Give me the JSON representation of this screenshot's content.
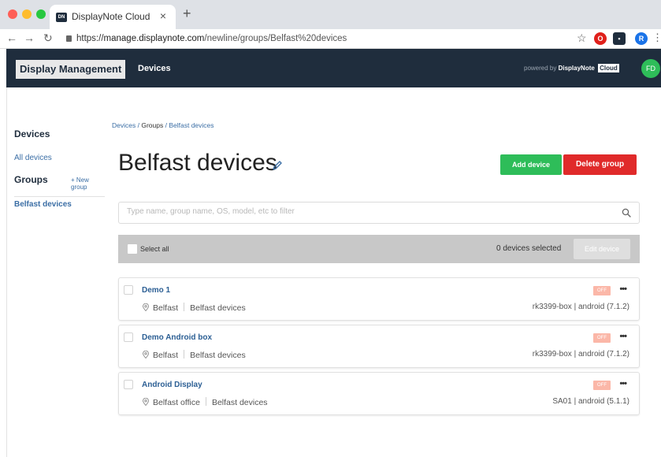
{
  "browser": {
    "tab_title": "DisplayNote Cloud",
    "favicon_text": "DN",
    "url_scheme": "https://",
    "url_domain": "manage.displaynote.com",
    "url_path": "/newline/groups/Belfast%20devices",
    "ext_profile_initial": "R"
  },
  "header": {
    "brand_label": "Display Management",
    "nav_devices": "Devices",
    "powered_prefix": "powered by",
    "powered_brand": "DisplayNote",
    "powered_badge": "Cloud",
    "avatar_initials": "FD",
    "colors": {
      "bg": "#1f2d3d",
      "avatar": "#2ebd59"
    }
  },
  "sidebar": {
    "title": "Devices",
    "all_devices": "All devices",
    "groups_title": "Groups",
    "new_group": "+ New group",
    "groups": [
      "Belfast devices"
    ]
  },
  "main": {
    "breadcrumb": {
      "devices": "Devices",
      "groups": "Groups",
      "current": "Belfast devices",
      "separator": "/"
    },
    "title": "Belfast devices",
    "add_device": "Add device",
    "delete_group": "Delete group",
    "filter_placeholder": "Type name, group name, OS, model, etc to filter",
    "select_all": "Select all",
    "selected_count": "0 devices selected",
    "edit_device": "Edit device",
    "colors": {
      "add": "#2ebd59",
      "delete": "#e02a2a",
      "link": "#3b6ea5",
      "off_badge": "#fbb7a8"
    }
  },
  "devices": [
    {
      "name": "Demo 1",
      "location": "Belfast",
      "group": "Belfast devices",
      "status": "OFF",
      "model": "rk3399-box | android (7.1.2)"
    },
    {
      "name": "Demo Android box",
      "location": "Belfast",
      "group": "Belfast devices",
      "status": "OFF",
      "model": "rk3399-box | android (7.1.2)"
    },
    {
      "name": "Android Display",
      "location": "Belfast office",
      "group": "Belfast devices",
      "status": "OFF",
      "model": "SA01 | android (5.1.1)"
    }
  ]
}
